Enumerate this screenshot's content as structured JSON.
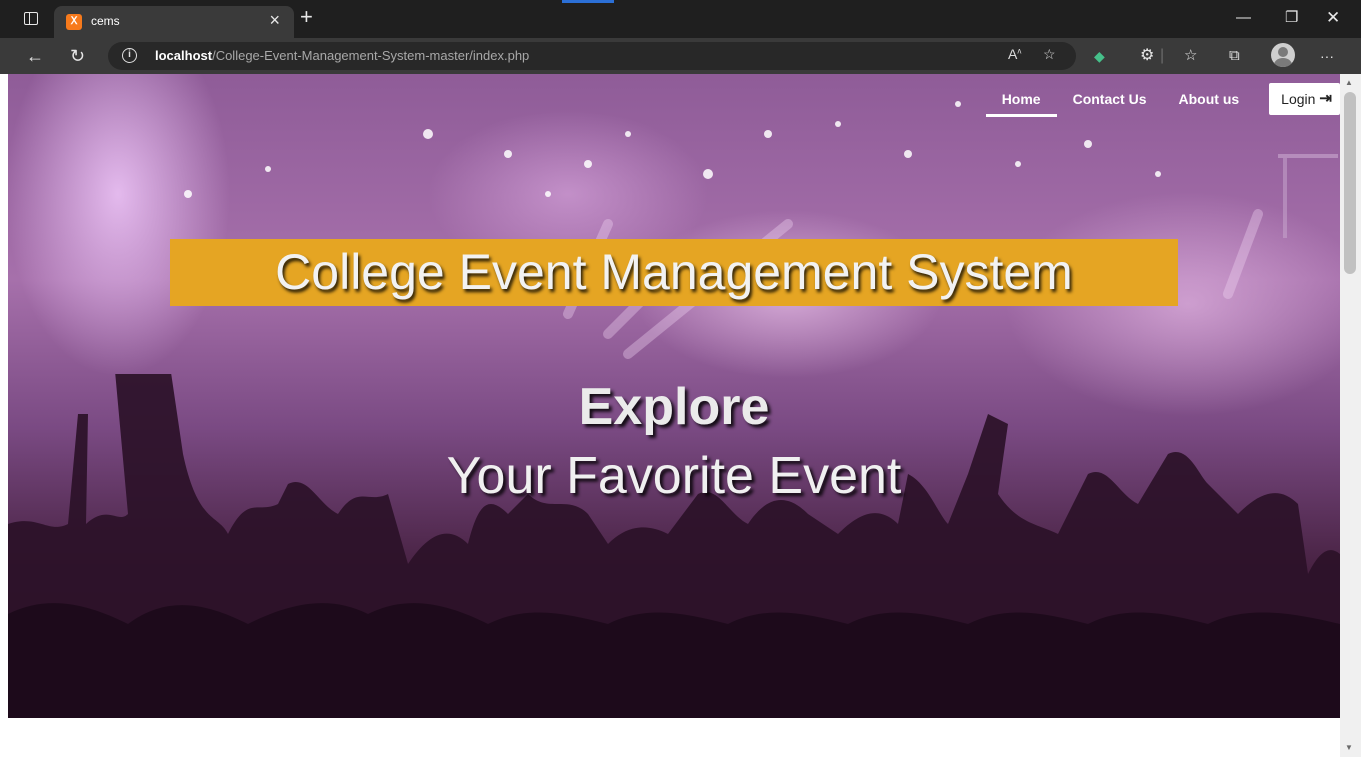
{
  "browser": {
    "tab": {
      "title": "cems",
      "favicon": "xampp-icon"
    },
    "url": {
      "host": "localhost",
      "path": "/College-Event-Management-System-master/index.php"
    },
    "icons": [
      "window-icon",
      "close-icon",
      "new-tab-icon",
      "minimize-icon",
      "restore-icon",
      "window-close-icon",
      "back-icon",
      "refresh-icon",
      "info-icon",
      "read-aloud-icon",
      "favorite-add-icon",
      "extension-icon",
      "extensions-icon",
      "favorites-icon",
      "collections-icon",
      "profile-icon",
      "more-icon"
    ]
  },
  "nav": {
    "items": [
      {
        "label": "Home",
        "active": true
      },
      {
        "label": "Contact Us",
        "active": false
      },
      {
        "label": "About us",
        "active": false
      }
    ],
    "login_label": "Login"
  },
  "hero": {
    "title": "College Event Management System",
    "tagline_line1": "Explore",
    "tagline_line2": "Your Favorite Event"
  },
  "colors": {
    "title_band": "#e5a523",
    "chrome_dark": "#1f1f1f",
    "chrome_toolbar": "#3a3a3a",
    "hero_tint": "#a670ab"
  }
}
